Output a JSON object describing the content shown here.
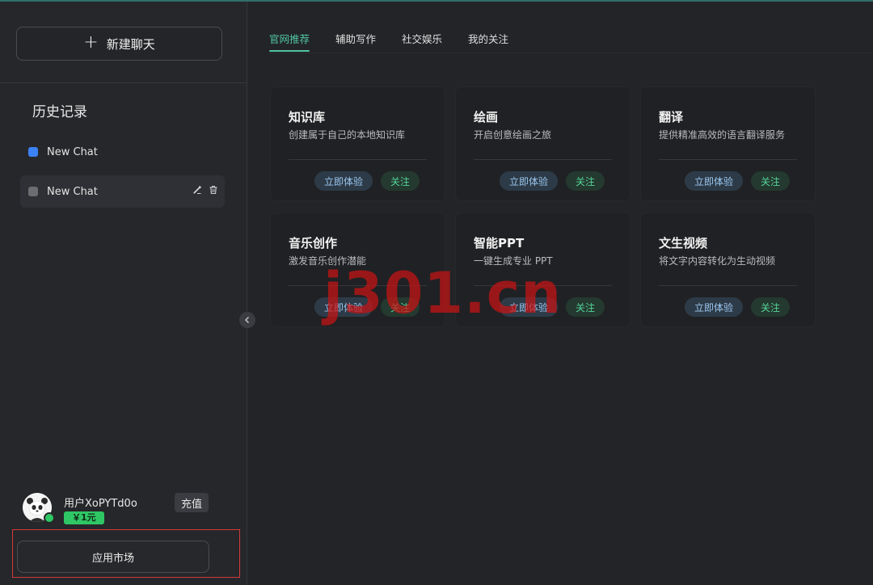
{
  "sidebar": {
    "new_chat_label": "新建聊天",
    "history_title": "历史记录",
    "history": [
      {
        "label": "New Chat",
        "color": "#3b82f6",
        "active": false
      },
      {
        "label": "New Chat",
        "color": "#6b6d72",
        "active": true
      }
    ],
    "user": {
      "name": "用户XoPYTd0o",
      "balance": "￥1元",
      "recharge_label": "充值"
    },
    "app_market_label": "应用市场"
  },
  "main": {
    "tabs": [
      {
        "label": "官网推荐",
        "active": true
      },
      {
        "label": "辅助写作",
        "active": false
      },
      {
        "label": "社交娱乐",
        "active": false
      },
      {
        "label": "我的关注",
        "active": false
      }
    ],
    "cards": [
      {
        "title": "知识库",
        "desc": "创建属于自己的本地知识库",
        "try_label": "立即体验",
        "follow_label": "关注"
      },
      {
        "title": "绘画",
        "desc": "开启创意绘画之旅",
        "try_label": "立即体验",
        "follow_label": "关注"
      },
      {
        "title": "翻译",
        "desc": "提供精准高效的语言翻译服务",
        "try_label": "立即体验",
        "follow_label": "关注"
      },
      {
        "title": "音乐创作",
        "desc": "激发音乐创作潜能",
        "try_label": "立即体验",
        "follow_label": "关注"
      },
      {
        "title": "智能PPT",
        "desc": "一键生成专业 PPT",
        "try_label": "立即体验",
        "follow_label": "关注"
      },
      {
        "title": "文生视频",
        "desc": "将文字内容转化为生动视频",
        "try_label": "立即体验",
        "follow_label": "关注"
      }
    ]
  },
  "watermark": "j301.cn",
  "colors": {
    "accent": "#4fc3a1",
    "online": "#2fc765",
    "highlight_box": "#d23b3b"
  }
}
